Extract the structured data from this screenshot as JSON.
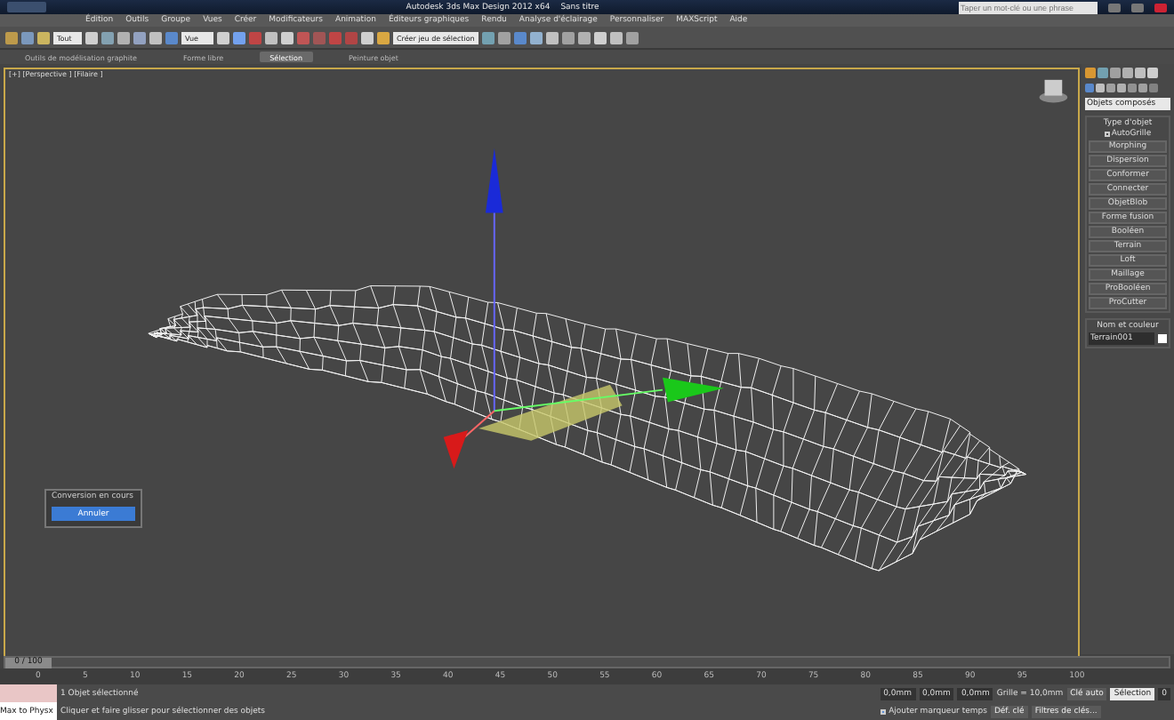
{
  "window": {
    "title": "Autodesk 3ds Max Design 2012 x64",
    "document": "Sans titre",
    "search_placeholder": "Taper un mot-clé ou une phrase"
  },
  "menu": [
    "Édition",
    "Outils",
    "Groupe",
    "Vues",
    "Créer",
    "Modificateurs",
    "Animation",
    "Éditeurs graphiques",
    "Rendu",
    "Analyse d'éclairage",
    "Personnaliser",
    "MAXScript",
    "Aide"
  ],
  "toolbar": {
    "selection_filter": "Tout",
    "reference": "Vue",
    "named_set": "Créer jeu de sélection"
  },
  "ribbon_tabs": [
    {
      "label": "Outils de modélisation graphite",
      "selected": false
    },
    {
      "label": "Forme libre",
      "selected": false
    },
    {
      "label": "Sélection",
      "selected": true
    },
    {
      "label": "Peinture objet",
      "selected": false
    }
  ],
  "viewport": {
    "label": "[+] [Perspective ] [Filaire ]"
  },
  "command_panel": {
    "category": "Objets composés",
    "rollout_title": "Type d'objet",
    "autogrid": {
      "label": "AutoGrille",
      "checked": false
    },
    "buttons": [
      "Morphing",
      "Dispersion",
      "Conformer",
      "Connecter",
      "ObjetBlob",
      "Forme fusion",
      "Booléen",
      "Terrain",
      "Loft",
      "Maillage",
      "ProBooléen",
      "ProCutter"
    ],
    "name_title": "Nom et couleur",
    "name_value": "Terrain001"
  },
  "dialog": {
    "title": "Conversion en cours",
    "button": "Annuler"
  },
  "timeline": {
    "position": "0 / 100",
    "level": 0,
    "ticks": [
      "0",
      "5",
      "10",
      "15",
      "20",
      "25",
      "30",
      "35",
      "40",
      "45",
      "50",
      "55",
      "60",
      "65",
      "70",
      "75",
      "80",
      "85",
      "90",
      "95",
      "100"
    ]
  },
  "status": {
    "listener": "Max to Physx",
    "selection": "1 Objet sélectionné",
    "prompt": "Cliquer et faire glisser pour sélectionner des objets",
    "x": "0,0mm",
    "y": "0,0mm",
    "z": "0,0mm",
    "grid": "Grille = 10,0mm",
    "time_tag": "Ajouter marqueur temps",
    "auto_key": "Clé auto",
    "key_mode": "Sélection",
    "set_key": "Déf. clé",
    "key_filters": "Filtres de clés...",
    "frame": "0"
  }
}
